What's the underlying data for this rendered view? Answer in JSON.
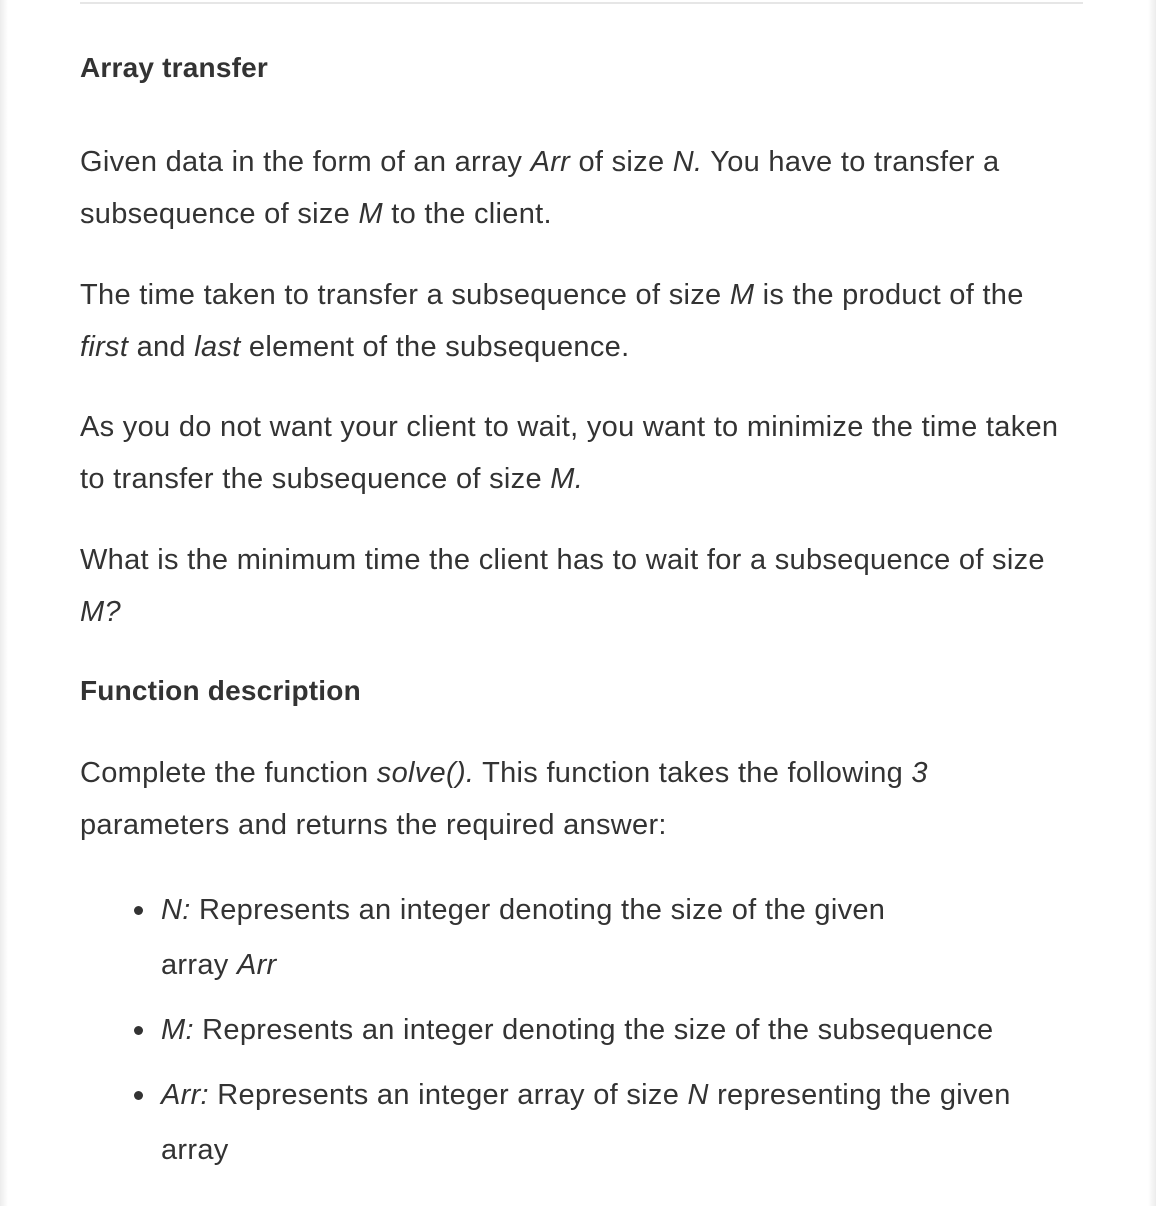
{
  "title": "Array transfer",
  "paragraphs": {
    "p1": {
      "a": "Given data in the form of an array ",
      "arr": "Arr",
      "b": " of size ",
      "n": "N.",
      "c": " You have to transfer a subsequence of size ",
      "m": "M",
      "d": " to the client."
    },
    "p2": {
      "a": "The time taken to transfer a subsequence of size ",
      "m": "M",
      "b": " is the product of the ",
      "first": "first",
      "c": " and ",
      "last": "last",
      "d": " element of the subsequence."
    },
    "p3": {
      "a": "As you do not want your client to wait, you want to minimize the time taken to transfer the subsequence of size ",
      "m": "M."
    },
    "p4": {
      "a": "What is the minimum time the client has to wait for a subsequence of size ",
      "m": "M?"
    }
  },
  "function_section": {
    "heading": "Function description",
    "intro": {
      "a": "Complete the function ",
      "fn": "solve().",
      "b": " This function takes the following ",
      "count": "3",
      "c": " parameters and returns the required answer:"
    },
    "params": [
      {
        "name": "N:",
        "desc_a": " Represents an integer denoting the size of the given array ",
        "desc_em": "Arr",
        "desc_b": ""
      },
      {
        "name": "M:",
        "desc_a": " Represents an integer denoting the size of the subsequence",
        "desc_em": "",
        "desc_b": ""
      },
      {
        "name": "Arr:",
        "desc_a": " Represents an integer array of size ",
        "desc_em": "N",
        "desc_b": " representing the given array"
      }
    ]
  }
}
